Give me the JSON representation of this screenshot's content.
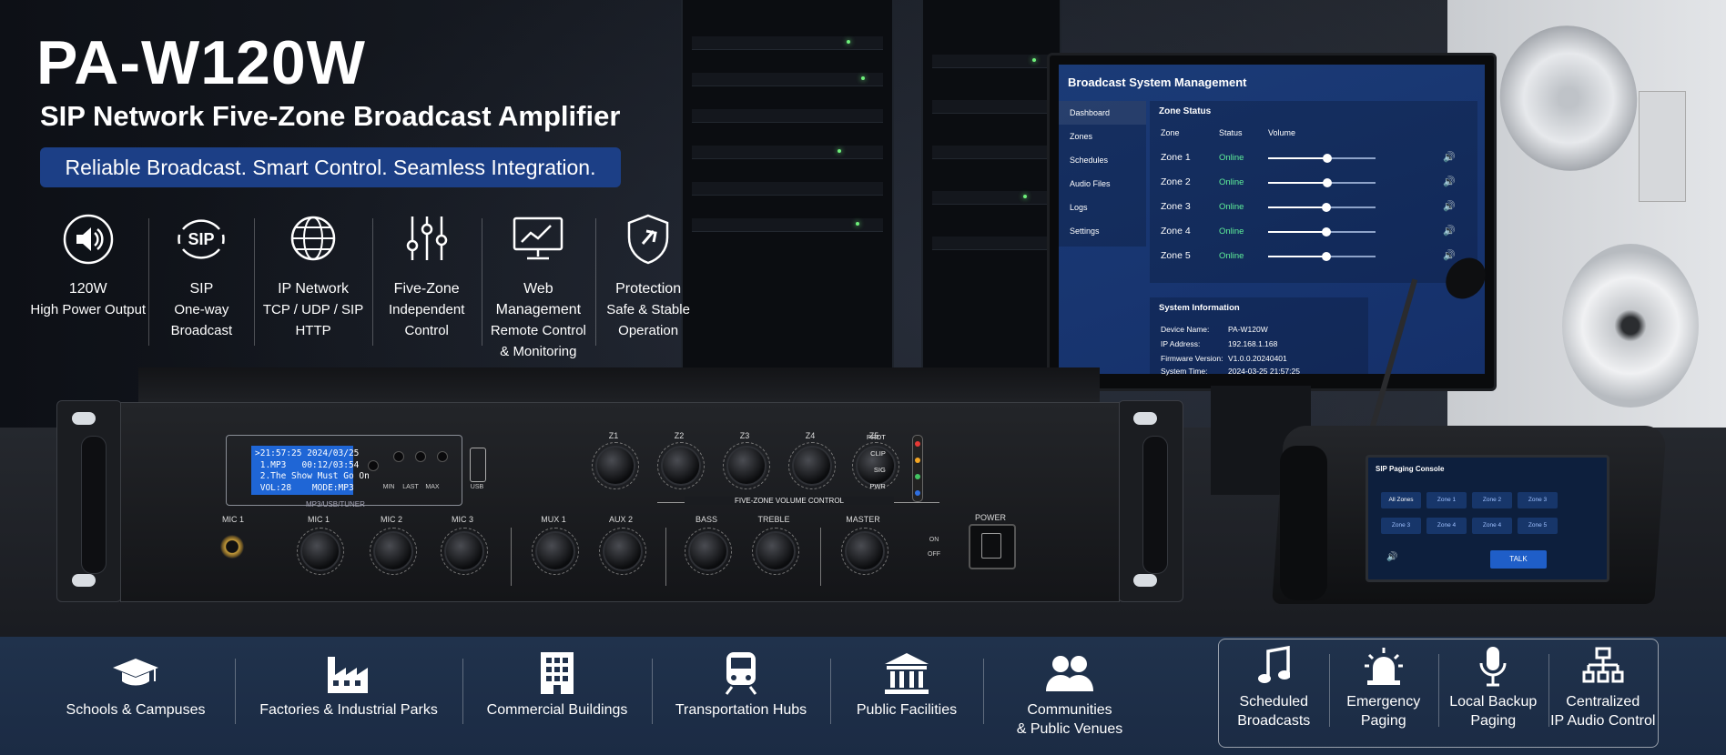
{
  "header": {
    "title": "PA-W120W",
    "subtitle": "SIP Network Five-Zone Broadcast Amplifier",
    "tagline": "Reliable Broadcast. Smart Control. Seamless Integration."
  },
  "features": [
    {
      "icon": "speaker-icon",
      "line1": "120W",
      "line2": "High Power Output",
      "line3": ""
    },
    {
      "icon": "sip-icon",
      "icon_text": "SIP",
      "line1": "SIP",
      "line2": "One-way",
      "line3": "Broadcast"
    },
    {
      "icon": "globe-icon",
      "line1": "IP Network",
      "line2": "TCP / UDP / SIP",
      "line3": "HTTP"
    },
    {
      "icon": "sliders-icon",
      "line1": "Five-Zone",
      "line2": "Independent",
      "line3": "Control"
    },
    {
      "icon": "monitor-chart-icon",
      "line1": "Web Management",
      "line2": "Remote Control",
      "line3": "& Monitoring"
    },
    {
      "icon": "shield-icon",
      "line1": "Protection",
      "line2": "Safe & Stable",
      "line3": "Operation"
    }
  ],
  "amplifier": {
    "lcd_lines": [
      ">21:57:25 2024/03/25",
      " 1.MP3   00:12/03:54",
      " 2.The Show Must Go On",
      " VOL:28    MODE:MP3"
    ],
    "tuner_label": "MP3/USB/TUNER",
    "small_buttons": [
      "MIN",
      "LAST",
      "MAX"
    ],
    "usb_label": "USB",
    "zone_knobs": [
      "Z1",
      "Z2",
      "Z3",
      "Z4",
      "Z5"
    ],
    "zone_bar_label": "FIVE-ZONE VOLUME CONTROL",
    "input_knobs": [
      "MIC 1",
      "MIC 2",
      "MIC 3",
      "MUX 1",
      "AUX 2",
      "BASS",
      "TREBLE",
      "MASTER"
    ],
    "mic_jack_label": "MIC 1",
    "knob_min": "MIN",
    "knob_max": "MAX",
    "tone_min": "-10",
    "tone_max": "+10",
    "indicators": [
      "PROT",
      "CLIP",
      "SIG",
      "PWR"
    ],
    "indicator_colors": [
      "#e53935",
      "#f5a623",
      "#43c463",
      "#2f6fe0"
    ],
    "power_label": "POWER",
    "on_label": "ON",
    "off_label": "OFF"
  },
  "monitor": {
    "title": "Broadcast System Management",
    "nav": [
      "Dashboard",
      "Zones",
      "Schedules",
      "Audio Files",
      "Logs",
      "Settings"
    ],
    "zone_status_heading": "Zone Status",
    "columns": {
      "zone": "Zone",
      "status": "Status",
      "volume": "Volume"
    },
    "zones": [
      {
        "name": "Zone 1",
        "status": "Online",
        "volume": 0.55
      },
      {
        "name": "Zone 2",
        "status": "Online",
        "volume": 0.55
      },
      {
        "name": "Zone 3",
        "status": "Online",
        "volume": 0.54
      },
      {
        "name": "Zone 4",
        "status": "Online",
        "volume": 0.54
      },
      {
        "name": "Zone 5",
        "status": "Online",
        "volume": 0.54
      }
    ],
    "system_heading": "System Information",
    "system": [
      {
        "label": "Device Name:",
        "value": "PA-W120W"
      },
      {
        "label": "IP Address:",
        "value": "192.168.1.168"
      },
      {
        "label": "Firmware Version:",
        "value": "V1.0.0.20240401"
      },
      {
        "label": "System Time:",
        "value": "2024-03-25  21:57:25"
      }
    ]
  },
  "console": {
    "title": "SIP Paging Console",
    "buttons": [
      "All Zones",
      "Zone 1",
      "Zone 2",
      "Zone 3",
      "Zone 3",
      "Zone 4",
      "Zone 4",
      "Zone 5"
    ],
    "talk_label": "TALK"
  },
  "applications": [
    {
      "icon": "graduation-cap-icon",
      "label1": "Schools & Campuses",
      "label2": ""
    },
    {
      "icon": "factory-icon",
      "label1": "Factories & Industrial Parks",
      "label2": ""
    },
    {
      "icon": "building-icon",
      "label1": "Commercial Buildings",
      "label2": ""
    },
    {
      "icon": "train-icon",
      "label1": "Transportation Hubs",
      "label2": ""
    },
    {
      "icon": "museum-icon",
      "label1": "Public Facilities",
      "label2": ""
    },
    {
      "icon": "people-icon",
      "label1": "Communities",
      "label2": "& Public Venues"
    }
  ],
  "functions": [
    {
      "icon": "music-note-icon",
      "label1": "Scheduled",
      "label2": "Broadcasts"
    },
    {
      "icon": "alarm-light-icon",
      "label1": "Emergency",
      "label2": "Paging"
    },
    {
      "icon": "microphone-icon",
      "label1": "Local Backup",
      "label2": "Paging"
    },
    {
      "icon": "network-tree-icon",
      "label1": "Centralized",
      "label2": "IP Audio Control"
    }
  ]
}
